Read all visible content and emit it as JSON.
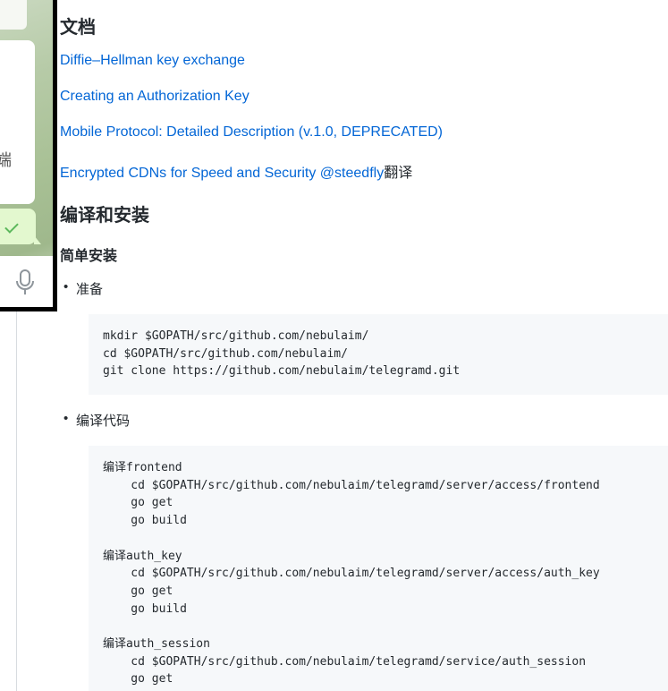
{
  "sidebar_mock": {
    "cut_glyph": "端"
  },
  "docs": {
    "heading": "文档",
    "links": [
      {
        "text": "Diffie–Hellman key exchange"
      },
      {
        "text": "Creating an Authorization Key"
      },
      {
        "text": "Mobile Protocol: Detailed Description (v.1.0, DEPRECATED)"
      },
      {
        "text": "Encrypted CDNs for Speed and Security @steedfly",
        "suffix": "翻译"
      }
    ]
  },
  "build": {
    "heading": "编译和安装",
    "subheading": "简单安装",
    "steps": [
      {
        "label": "准备",
        "code": "mkdir $GOPATH/src/github.com/nebulaim/\ncd $GOPATH/src/github.com/nebulaim/\ngit clone https://github.com/nebulaim/telegramd.git"
      },
      {
        "label": "编译代码",
        "code": "编译frontend\n    cd $GOPATH/src/github.com/nebulaim/telegramd/server/access/frontend\n    go get\n    go build\n\n编译auth_key\n    cd $GOPATH/src/github.com/nebulaim/telegramd/server/access/auth_key\n    go get\n    go build\n\n编译auth_session\n    cd $GOPATH/src/github.com/nebulaim/telegramd/service/auth_session\n    go get"
      }
    ]
  },
  "colors": {
    "link": "#0366d6",
    "text": "#24292e",
    "code_bg": "#f6f8fa"
  }
}
